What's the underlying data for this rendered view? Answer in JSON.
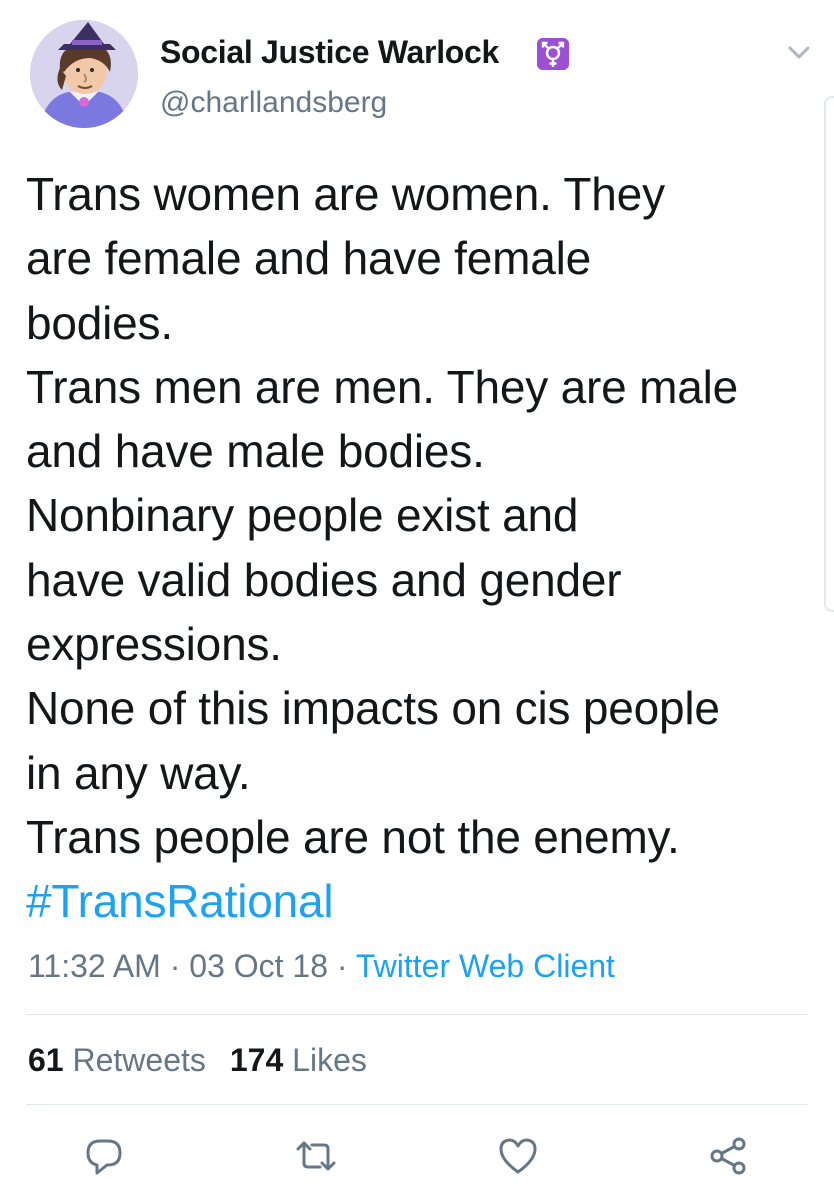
{
  "author": {
    "display_name": "Social Justice Warlock",
    "name_emoji": "transgender-symbol-emoji",
    "handle": "@charllandsberg",
    "avatar": "cartoon-warlock-avatar"
  },
  "tweet": {
    "lines": [
      "Trans women are women. They",
      "are female and have female",
      "bodies.",
      "Trans men are men. They are male",
      "and have male bodies.",
      "Nonbinary people exist and",
      "have valid bodies and gender",
      "expressions.",
      "None of this impacts on cis people",
      "in any way.",
      "Trans people are not the enemy."
    ],
    "hashtag": "#TransRational"
  },
  "meta": {
    "time": "11:32 AM",
    "sep1": " · ",
    "date": "03 Oct 18",
    "sep2": " · ",
    "source": "Twitter Web Client"
  },
  "stats": {
    "retweets_count": "61",
    "retweets_label": "Retweets",
    "likes_count": "174",
    "likes_label": "Likes"
  },
  "actions": [
    "reply-icon",
    "retweet-icon",
    "like-icon",
    "share-icon"
  ],
  "colors": {
    "link": "#1da1f2",
    "secondary_text": "#657786",
    "primary_text": "#14171a",
    "divider": "#e1e8ed",
    "emoji_bg": "#9b4fd3"
  }
}
